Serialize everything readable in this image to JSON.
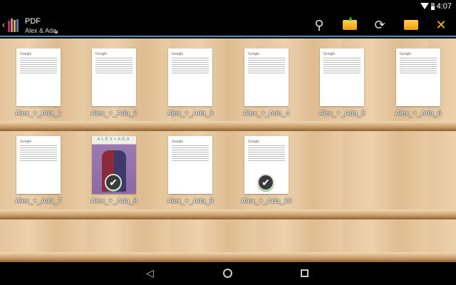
{
  "status": {
    "time": "4:07"
  },
  "header": {
    "title": "PDF",
    "subtitle": "Alex & Ada"
  },
  "toolbar": {
    "icons": [
      "search-icon",
      "import-folder-icon",
      "refresh-icon",
      "open-folder-icon",
      "settings-tools-icon"
    ]
  },
  "books": [
    {
      "label": "Alex_+_Ada_1",
      "selected": false,
      "cover": "document"
    },
    {
      "label": "Alex_+_Ada_2",
      "selected": false,
      "cover": "document"
    },
    {
      "label": "Alex_+_Ada_3",
      "selected": false,
      "cover": "document"
    },
    {
      "label": "Alex_+_Ada_4",
      "selected": false,
      "cover": "document"
    },
    {
      "label": "Alex_+_Ada_5",
      "selected": false,
      "cover": "document"
    },
    {
      "label": "Alex_+_Ada_6",
      "selected": false,
      "cover": "document"
    },
    {
      "label": "Alex_+_Ada_7",
      "selected": false,
      "cover": "document"
    },
    {
      "label": "Alex_+_Ada_8",
      "selected": true,
      "cover": "comic",
      "cover_title": "ALEX+ADA"
    },
    {
      "label": "Alex_+_Ada_9",
      "selected": false,
      "cover": "document"
    },
    {
      "label": "Alex_+_Ada_10",
      "selected": true,
      "cover": "document"
    }
  ],
  "doc_heading": "Google"
}
